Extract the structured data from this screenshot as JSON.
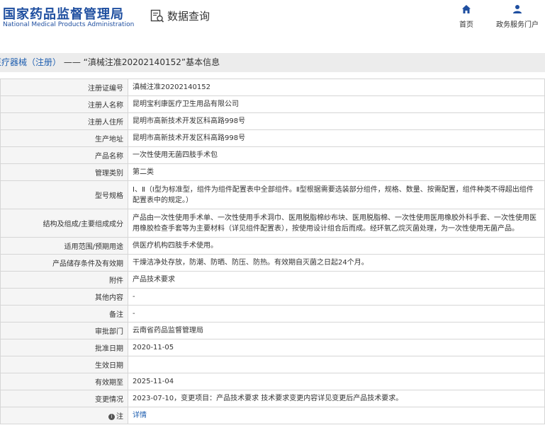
{
  "header": {
    "logo_cn": "国家药品监督管理局",
    "logo_en": "National Medical Products Administration",
    "search_title": "数据查询",
    "nav": [
      {
        "label": "首页",
        "icon": "home-icon"
      },
      {
        "label": "政务服务门户",
        "icon": "user-icon"
      }
    ]
  },
  "breadcrumb": {
    "category": "医疗器械（注册）",
    "separator": " —— ",
    "title": "“滇械注准20202140152”基本信息"
  },
  "info_rows": [
    {
      "label": "注册证编号",
      "value": "滇械注准20202140152"
    },
    {
      "label": "注册人名称",
      "value": "昆明宝利康医疗卫生用品有限公司"
    },
    {
      "label": "注册人住所",
      "value": "昆明市高新技术开发区科高路998号"
    },
    {
      "label": "生产地址",
      "value": "昆明市高新技术开发区科高路998号"
    },
    {
      "label": "产品名称",
      "value": "一次性使用无菌四肢手术包"
    },
    {
      "label": "管理类别",
      "value": "第二类"
    },
    {
      "label": "型号规格",
      "value": "Ⅰ、Ⅱ（Ⅰ型为标准型，组件为组件配置表中全部组件。Ⅱ型根据需要选装部分组件，规格、数量、按需配置，组件种类不得超出组件配置表中的规定。）"
    },
    {
      "label": "结构及组成/主要组成成分",
      "value": "产品由一次性使用手术单、一次性使用手术洞巾、医用脱脂棉纱布块、医用脱脂棉、一次性使用医用橡胶外科手套、一次性使用医用橡胶检查手套等为主要材料（详见组件配置表），按使用设计组合后而成。经环氧乙烷灭菌处理，为一次性使用无菌产品。"
    },
    {
      "label": "适用范围/预期用途",
      "value": "供医疗机构四肢手术使用。"
    },
    {
      "label": "产品储存条件及有效期",
      "value": "干燥洁净处存放，防潮、防晒、防压、防热。有效期自灭菌之日起24个月。"
    },
    {
      "label": "附件",
      "value": "产品技术要求"
    },
    {
      "label": "其他内容",
      "value": "-"
    },
    {
      "label": "备注",
      "value": "-"
    },
    {
      "label": "审批部门",
      "value": "云南省药品监督管理局"
    },
    {
      "label": "批准日期",
      "value": "2020-11-05"
    },
    {
      "label": "生效日期",
      "value": ""
    },
    {
      "label": "有效期至",
      "value": "2025-11-04"
    },
    {
      "label": "变更情况",
      "value": "2023-07-10，变更项目：产品技术要求 技术要求变更内容详见变更后产品技术要求。"
    }
  ],
  "note_row": {
    "label": "注",
    "value": "详情"
  },
  "colors": {
    "brand_blue": "#1f4fa0",
    "link_blue": "#1f5fb0",
    "title_bar_bg": "#ececec",
    "label_bg": "#f5f5f5"
  }
}
